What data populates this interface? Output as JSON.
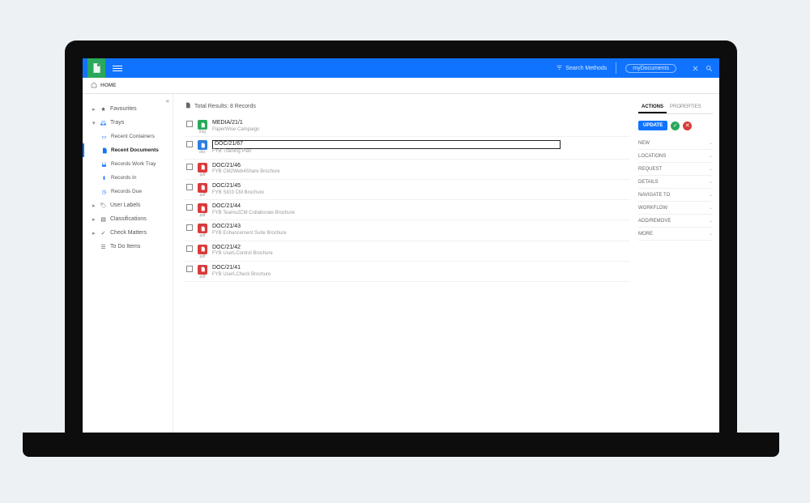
{
  "header": {
    "search_label": "Search Methods",
    "context": "myDocuments"
  },
  "breadcrumb": {
    "label": "HOME"
  },
  "sidebar": {
    "items": [
      {
        "label": "Favourites",
        "expandable": true
      },
      {
        "label": "Trays",
        "expandable": true,
        "expanded": true
      },
      {
        "label": "User Labels",
        "expandable": true
      },
      {
        "label": "Classifications",
        "expandable": true
      },
      {
        "label": "Check Matters",
        "expandable": true
      },
      {
        "label": "To Do Items",
        "expandable": false
      }
    ],
    "trays_children": [
      {
        "label": "Recent Containers"
      },
      {
        "label": "Recent Documents",
        "active": true
      },
      {
        "label": "Records Work Tray"
      },
      {
        "label": "Records In"
      },
      {
        "label": "Records Due"
      }
    ]
  },
  "list": {
    "header": "Total Results: 8 Records",
    "rows": [
      {
        "id": "MEDIA/21/1",
        "sub": "PaperWise Campaign",
        "ext": "img",
        "color": "green"
      },
      {
        "id": "DOC/21/67",
        "sub": "FYB Training Plan",
        "ext": "doc",
        "color": "blue",
        "selected": true
      },
      {
        "id": "DOC/21/46",
        "sub": "FYB CM2Web4Share Brochure",
        "ext": "pdf",
        "color": "red"
      },
      {
        "id": "DOC/21/45",
        "sub": "FYB SIG3 CM Brochure",
        "ext": "pdf",
        "color": "red"
      },
      {
        "id": "DOC/21/44",
        "sub": "FYB Teams2CM Collaborate Brochure",
        "ext": "pdf",
        "color": "red"
      },
      {
        "id": "DOC/21/43",
        "sub": "FYB Enhancement Suite Brochure",
        "ext": "pdf",
        "color": "red"
      },
      {
        "id": "DOC/21/42",
        "sub": "FYB UserLControl Brochure",
        "ext": "pdf",
        "color": "red"
      },
      {
        "id": "DOC/21/41",
        "sub": "FYB UserLCheck Brochure",
        "ext": "pdf",
        "color": "red"
      }
    ]
  },
  "panel": {
    "tabs": [
      "ACTIONS",
      "PROPERTIES"
    ],
    "active_tab": 0,
    "update_label": "UPDATE",
    "sections": [
      "NEW",
      "LOCATIONS",
      "REQUEST",
      "DETAILS",
      "NAVIGATE TO",
      "WORKFLOW",
      "ADD/REMOVE",
      "MORE"
    ]
  }
}
